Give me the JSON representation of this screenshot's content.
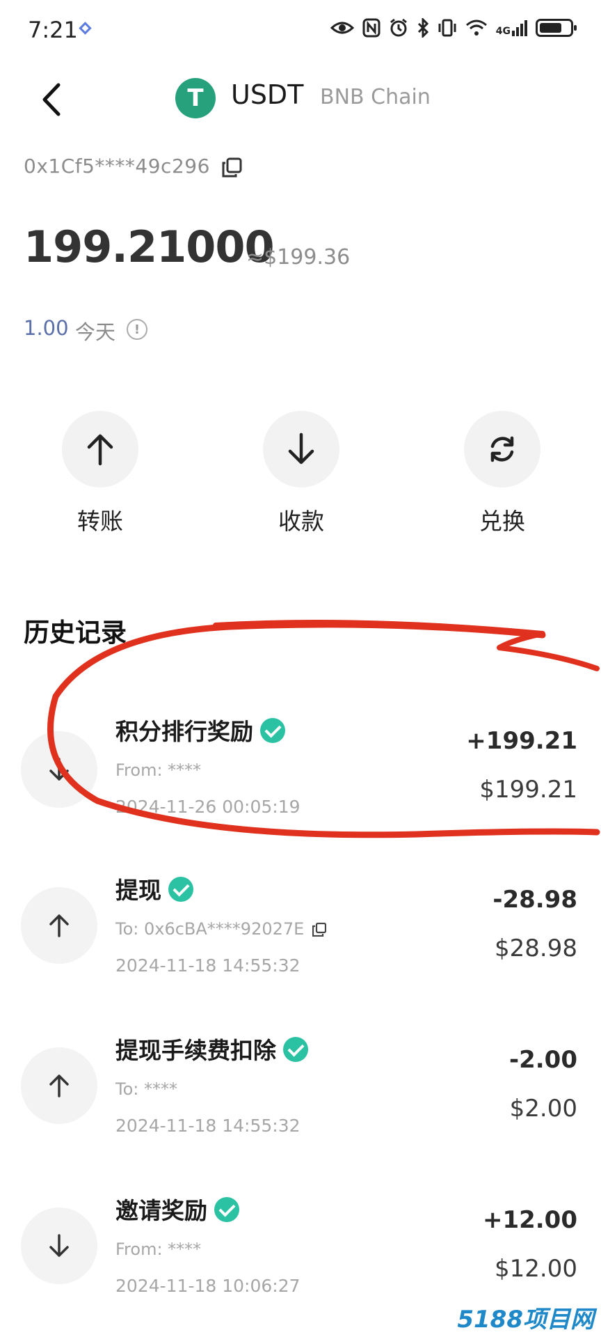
{
  "status_bar": {
    "time": "7:21",
    "network_label": "4G"
  },
  "header": {
    "token_symbol": "USDT",
    "chain": "BNB Chain",
    "logo_glyph": "T"
  },
  "wallet": {
    "address": "0x1Cf5****49c296",
    "balance": "199.21000",
    "balance_usd": "≈$199.36",
    "today_change": "1.00",
    "today_label": "今天"
  },
  "actions": [
    {
      "label": "转账",
      "icon": "arrow-up-icon"
    },
    {
      "label": "收款",
      "icon": "arrow-down-icon"
    },
    {
      "label": "兑换",
      "icon": "swap-icon"
    }
  ],
  "history": {
    "title": "历史记录",
    "items": [
      {
        "title": "积分排行奖励",
        "party": "From: ****",
        "time": "2024-11-26 00:05:19",
        "amount": "+199.21",
        "usd": "$199.21",
        "direction": "in"
      },
      {
        "title": "提现",
        "party": "To: 0x6cBA****92027E",
        "time": "2024-11-18 14:55:32",
        "amount": "-28.98",
        "usd": "$28.98",
        "direction": "out"
      },
      {
        "title": "提现手续费扣除",
        "party": "To: ****",
        "time": "2024-11-18 14:55:32",
        "amount": "-2.00",
        "usd": "$2.00",
        "direction": "out"
      },
      {
        "title": "邀请奖励",
        "party": "From: ****",
        "time": "2024-11-18 10:06:27",
        "amount": "+12.00",
        "usd": "$12.00",
        "direction": "in"
      }
    ]
  },
  "colors": {
    "tether_green": "#26a17b",
    "check_teal": "#2bc2a3",
    "scribble_red": "#e0301e"
  },
  "watermark": "5188项目网"
}
